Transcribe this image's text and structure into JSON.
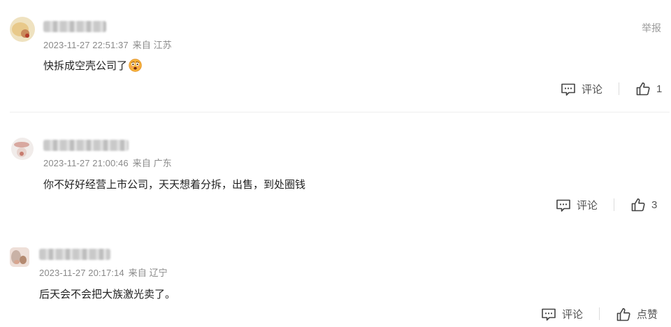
{
  "comments": [
    {
      "time": "2023-11-27 22:51:37",
      "location": "来自 江苏",
      "text": "快拆成空壳公司了",
      "emoji": "astonished-face-emoji",
      "report_label": "举报",
      "reply_label": "评论",
      "like_count": "1"
    },
    {
      "time": "2023-11-27 21:00:46",
      "location": "来自 广东",
      "text": "你不好好经营上市公司，天天想着分拆，出售，到处圈钱",
      "reply_label": "评论",
      "like_count": "3"
    },
    {
      "time": "2023-11-27 20:17:14",
      "location": "来自 辽宁",
      "text": "后天会不会把大族激光卖了。",
      "reply_label": "评论",
      "like_label": "点赞"
    }
  ],
  "icons": {
    "reply": "comment-bubble-icon",
    "like": "thumbs-up-icon"
  },
  "colors": {
    "meta_text": "#8a8a8a",
    "action_text": "#555555",
    "body_text": "#222222"
  }
}
